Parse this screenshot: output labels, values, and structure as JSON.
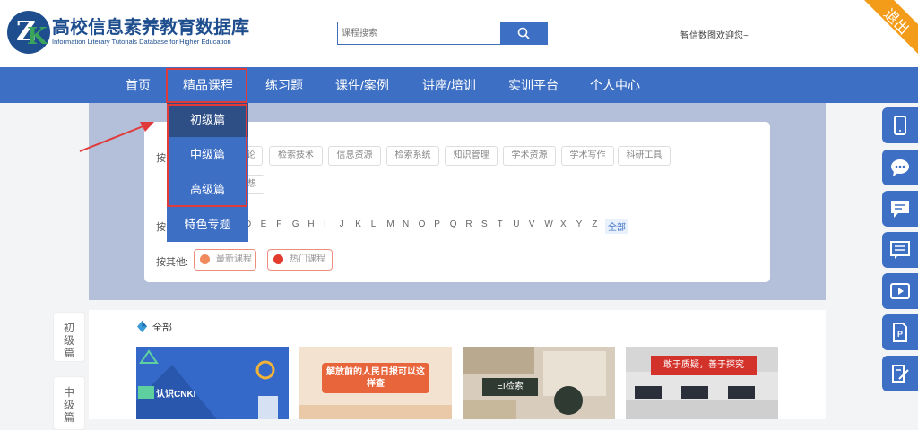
{
  "header": {
    "logo_title": "高校信息素养教育数据库",
    "logo_subtitle": "Information Literary Tutorials Database for Higher Education",
    "search_placeholder": "课程搜索",
    "welcome": "智信数图欢迎您~",
    "exit_label": "退出"
  },
  "nav": {
    "items": [
      "首页",
      "精品课程",
      "练习题",
      "课件/案例",
      "讲座/培训",
      "实训平台",
      "个人中心"
    ]
  },
  "dropdown": {
    "items": [
      "初级篇",
      "中级篇",
      "高级篇",
      "特色专题"
    ]
  },
  "filter": {
    "row1_label": "按",
    "row1_tags": [
      "论",
      "检索技术",
      "信息资源",
      "检索系统",
      "知识管理",
      "学术资源",
      "学术写作",
      "科研工具"
    ],
    "row1_extra_tag": "想",
    "row2_label": "按",
    "letters": [
      "D",
      "E",
      "F",
      "G",
      "H",
      "I",
      "J",
      "K",
      "L",
      "M",
      "N",
      "O",
      "P",
      "Q",
      "R",
      "S",
      "T",
      "U",
      "V",
      "W",
      "X",
      "Y",
      "Z"
    ],
    "letters_all": "全部",
    "row3_label": "按其他:",
    "other_tags": [
      "最新课程",
      "热门课程"
    ]
  },
  "side_tabs": [
    "初级篇",
    "中级篇"
  ],
  "content": {
    "all_label": "全部",
    "cards": [
      {
        "text": "认识CNKI",
        "bg": "#3569c9"
      },
      {
        "text": "解放前的人民日报可以这样查",
        "bg": "#f2e2cf"
      },
      {
        "text": "EI检索",
        "bg": "#d8cdbd"
      },
      {
        "text": "敢于质疑，善于探究",
        "bg": "#e5e5e5"
      }
    ]
  },
  "colors": {
    "primary": "#3d6fc4",
    "accent": "#f39c1a",
    "highlight": "#e03a3a"
  },
  "right_bar_icons": [
    "phone-icon",
    "chat-bubble-icon",
    "message-icon",
    "comment-list-icon",
    "video-icon",
    "ppt-icon",
    "edit-icon"
  ]
}
